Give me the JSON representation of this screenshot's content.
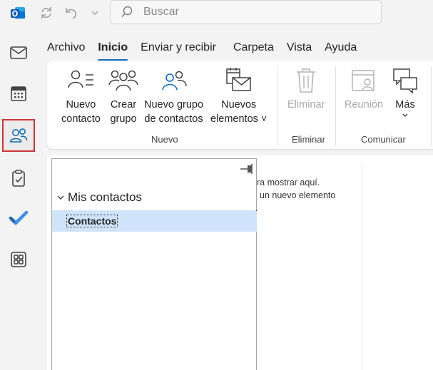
{
  "search": {
    "placeholder": "Buscar"
  },
  "menu": {
    "tabs": [
      {
        "label": "Archivo",
        "active": false
      },
      {
        "label": "Inicio",
        "active": true
      },
      {
        "label": "Enviar y recibir",
        "active": false
      },
      {
        "label": "Carpeta",
        "active": false
      },
      {
        "label": "Vista",
        "active": false
      },
      {
        "label": "Ayuda",
        "active": false
      }
    ]
  },
  "ribbon": {
    "nuevo_contacto": [
      "Nuevo",
      "contacto"
    ],
    "crear_grupo": [
      "Crear",
      "grupo"
    ],
    "nuevo_grupo": [
      "Nuevo grupo",
      "de contactos"
    ],
    "nuevos_elementos": [
      "Nuevos",
      "elementos ˅"
    ],
    "eliminar": "Eliminar",
    "reunion": "Reunión",
    "mas": "Más",
    "groups": {
      "nuevo": "Nuevo",
      "eliminar": "Eliminar",
      "comunicar": "Comunicar"
    }
  },
  "folders": {
    "heading": "Mis contactos",
    "items": [
      {
        "label": "Contactos",
        "selected": true
      }
    ]
  },
  "message": {
    "line1": "ra mostrar aquí.",
    "line2": "un nuevo elemento",
    "line3": "."
  },
  "colors": {
    "accent": "#0f6cbd",
    "rail_active_outline": "#d13438",
    "selected": "#cfe4fa"
  }
}
